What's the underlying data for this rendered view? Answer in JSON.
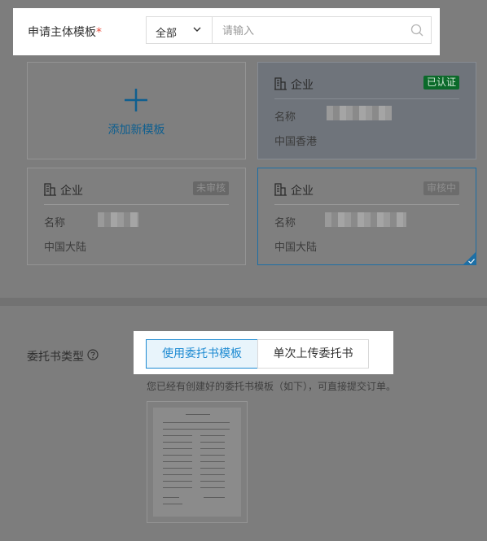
{
  "filter": {
    "label": "申请主体模板",
    "required_mark": "*",
    "select_value": "全部",
    "search_placeholder": "请输入"
  },
  "cards": {
    "add_new": "添加新模板",
    "items": [
      {
        "type": "企业",
        "status": "已认证",
        "name_label": "名称",
        "region": "中国香港"
      },
      {
        "type": "企业",
        "status": "未审核",
        "name_label": "名称",
        "region": "中国大陆"
      },
      {
        "type": "企业",
        "status": "审核中",
        "name_label": "名称",
        "region": "中国大陆"
      }
    ]
  },
  "authorization": {
    "label": "委托书类型",
    "options": [
      "使用委托书模板",
      "单次上传委托书"
    ],
    "selected_index": 0,
    "hint": "您已经有创建好的委托书模板（如下），可直接提交订单。"
  },
  "colors": {
    "accent": "#1d8ad2",
    "verified": "#0b6a2a",
    "required": "#e74c3c"
  },
  "icons": [
    "chevron-down-icon",
    "search-icon",
    "plus-icon",
    "building-icon",
    "help-icon",
    "check-icon"
  ]
}
